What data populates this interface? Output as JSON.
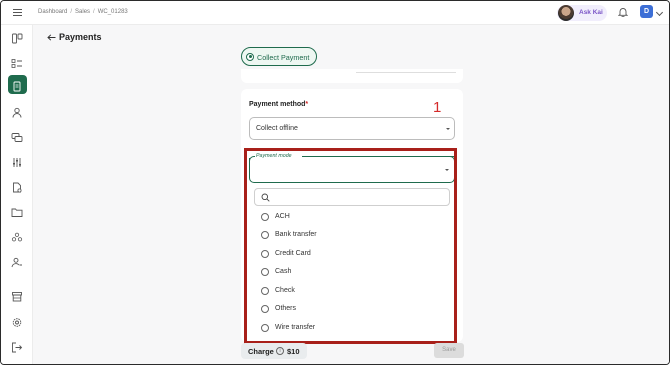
{
  "topbar": {
    "breadcrumbs": [
      "Dashboard",
      "Sales",
      "WC_01283"
    ],
    "ask_kai_label": "Ask Kai",
    "user_initial": "D"
  },
  "sidebar": {
    "items": [
      {
        "icon": "board-icon",
        "active": false
      },
      {
        "icon": "checklist-icon",
        "active": false
      },
      {
        "icon": "invoice-icon",
        "active": true
      },
      {
        "icon": "person-icon",
        "active": false
      },
      {
        "icon": "chat-icon",
        "active": false
      },
      {
        "icon": "sliders-icon",
        "active": false
      },
      {
        "icon": "document-icon",
        "active": false
      },
      {
        "icon": "folder-icon",
        "active": false
      },
      {
        "icon": "team-icon",
        "active": false
      },
      {
        "icon": "user-settings-icon",
        "active": false
      },
      {
        "icon": "store-icon",
        "active": false
      },
      {
        "icon": "gear-icon",
        "active": false
      },
      {
        "icon": "logout-icon",
        "active": false
      }
    ]
  },
  "page": {
    "title": "Payments",
    "collect_payment_label": "Collect Payment"
  },
  "form": {
    "payment_method_label": "Payment method",
    "required_mark": "*",
    "payment_method_value": "Collect offline",
    "payment_mode_label": "Payment mode",
    "annotation_number": "1",
    "search_placeholder": "",
    "options": [
      "ACH",
      "Bank transfer",
      "Credit Card",
      "Cash",
      "Check",
      "Others",
      "Wire transfer"
    ]
  },
  "footer": {
    "charge_label": "Charge",
    "charge_amount": "$10",
    "save_label": "Save"
  },
  "colors": {
    "brand_green": "#1f6b4d",
    "highlight_red": "#a8201a",
    "annotation_red": "#d42b2b"
  }
}
